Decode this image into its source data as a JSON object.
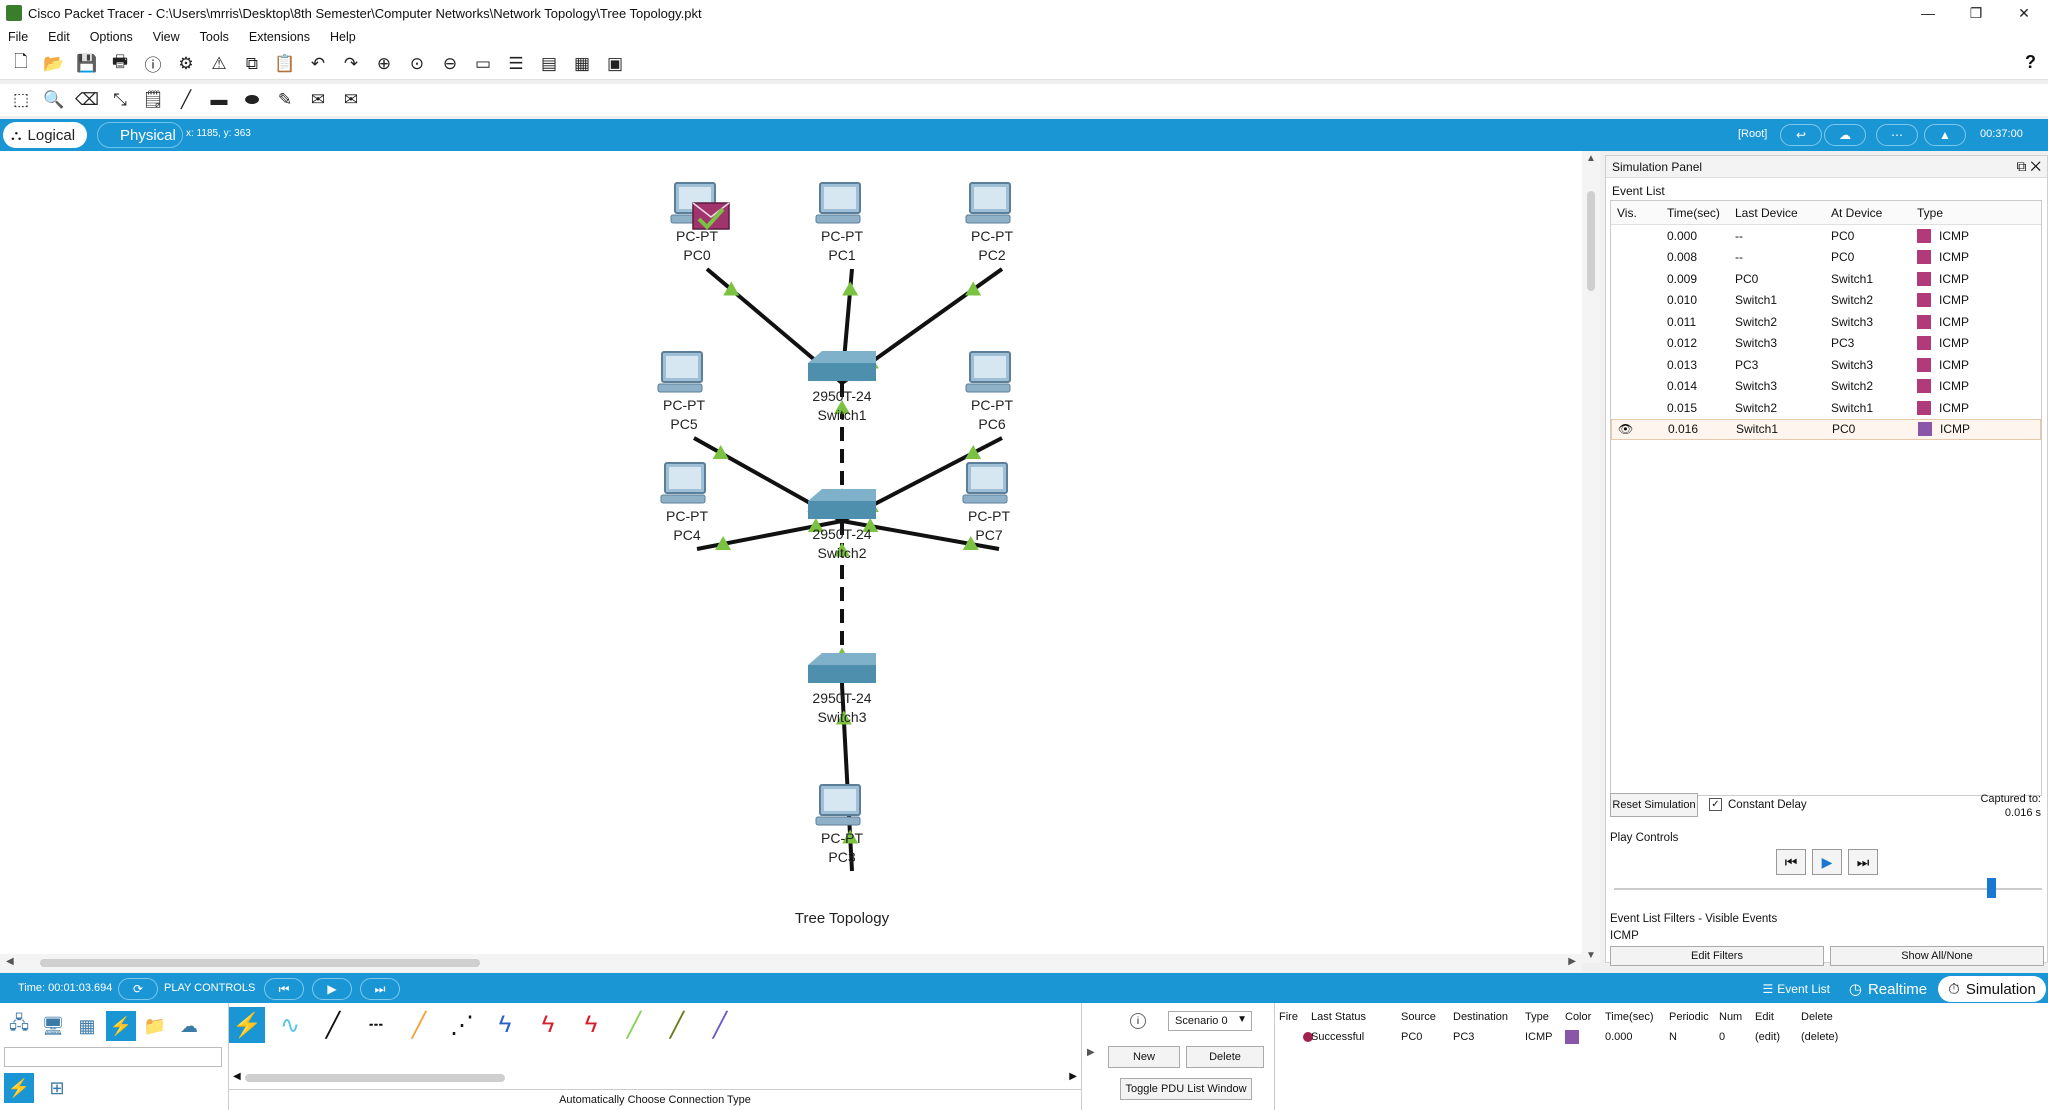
{
  "window": {
    "title": "Cisco Packet Tracer - C:\\Users\\mrris\\Desktop\\8th Semester\\Computer Networks\\Network Topology\\Tree Topology.pkt",
    "controls": [
      "—",
      "❐",
      "✕"
    ]
  },
  "menu": [
    "File",
    "Edit",
    "Options",
    "View",
    "Tools",
    "Extensions",
    "Help"
  ],
  "toolbar1": {
    "icons": [
      "new-icon",
      "open-icon",
      "save-icon",
      "print-icon",
      "info-icon",
      "wizard-icon",
      "network-info-icon",
      "copy-icon",
      "paste-icon",
      "undo-icon",
      "redo-icon",
      "zoom-in-icon",
      "zoom-reset-icon",
      "zoom-out-icon",
      "drawing-palette-icon",
      "custom-device-icon",
      "viewport-icon",
      "activity-wizard-icon",
      "screenshot-icon"
    ],
    "help": "?"
  },
  "toolbar2": {
    "icons": [
      "select-icon",
      "inspect-icon",
      "delete-icon",
      "resize-icon",
      "note-icon",
      "draw-line-icon",
      "rectangle-icon",
      "ellipse-icon",
      "freeform-icon",
      "add-simple-pdu-icon",
      "add-complex-pdu-icon"
    ]
  },
  "modebar": {
    "logical": "Logical",
    "physical": "Physical",
    "coords": "x: 1185, y: 363",
    "root": "[Root]",
    "clock": "00:37:00"
  },
  "topology": {
    "devices": [
      {
        "id": "pc0",
        "model": "PC-PT",
        "name": "PC0",
        "kind": "pc"
      },
      {
        "id": "pc1",
        "model": "PC-PT",
        "name": "PC1",
        "kind": "pc"
      },
      {
        "id": "pc2",
        "model": "PC-PT",
        "name": "PC2",
        "kind": "pc"
      },
      {
        "id": "pc5",
        "model": "PC-PT",
        "name": "PC5",
        "kind": "pc"
      },
      {
        "id": "pc6",
        "model": "PC-PT",
        "name": "PC6",
        "kind": "pc"
      },
      {
        "id": "pc4",
        "model": "PC-PT",
        "name": "PC4",
        "kind": "pc"
      },
      {
        "id": "pc7",
        "model": "PC-PT",
        "name": "PC7",
        "kind": "pc"
      },
      {
        "id": "pc3",
        "model": "PC-PT",
        "name": "PC3",
        "kind": "pc"
      },
      {
        "id": "sw1",
        "model": "2950T-24",
        "name": "Switch1",
        "kind": "switch"
      },
      {
        "id": "sw2",
        "model": "2950T-24",
        "name": "Switch2",
        "kind": "switch"
      },
      {
        "id": "sw3",
        "model": "2950T-24",
        "name": "Switch3",
        "kind": "switch"
      }
    ],
    "caption": "Tree Topology",
    "link_status_color": "#7cc242"
  },
  "sim_panel": {
    "title": "Simulation Panel",
    "event_list_title": "Event List",
    "columns": [
      "Vis.",
      "Time(sec)",
      "Last Device",
      "At Device",
      "Type"
    ],
    "events": [
      {
        "time": "0.000",
        "last": "--",
        "at": "PC0",
        "type": "ICMP",
        "color": "#b03a7a"
      },
      {
        "time": "0.008",
        "last": "--",
        "at": "PC0",
        "type": "ICMP",
        "color": "#b03a7a"
      },
      {
        "time": "0.009",
        "last": "PC0",
        "at": "Switch1",
        "type": "ICMP",
        "color": "#b03a7a"
      },
      {
        "time": "0.010",
        "last": "Switch1",
        "at": "Switch2",
        "type": "ICMP",
        "color": "#b03a7a"
      },
      {
        "time": "0.011",
        "last": "Switch2",
        "at": "Switch3",
        "type": "ICMP",
        "color": "#b03a7a"
      },
      {
        "time": "0.012",
        "last": "Switch3",
        "at": "PC3",
        "type": "ICMP",
        "color": "#b03a7a"
      },
      {
        "time": "0.013",
        "last": "PC3",
        "at": "Switch3",
        "type": "ICMP",
        "color": "#b03a7a"
      },
      {
        "time": "0.014",
        "last": "Switch3",
        "at": "Switch2",
        "type": "ICMP",
        "color": "#b03a7a"
      },
      {
        "time": "0.015",
        "last": "Switch2",
        "at": "Switch1",
        "type": "ICMP",
        "color": "#b03a7a"
      },
      {
        "time": "0.016",
        "last": "Switch1",
        "at": "PC0",
        "type": "ICMP",
        "color": "#8a56a8",
        "selected": true
      }
    ],
    "reset": "Reset Simulation",
    "constant_delay": "Constant Delay",
    "captured_label": "Captured to:",
    "captured_value": "0.016 s",
    "play_controls": "Play Controls",
    "slider_position": 0.88,
    "filters_title": "Event List Filters - Visible Events",
    "filters_value": "ICMP",
    "edit_filters": "Edit Filters",
    "show_all": "Show All/None"
  },
  "bottombar": {
    "time": "Time: 00:01:03.694",
    "play_controls": "PLAY CONTROLS",
    "event_list": "Event List",
    "realtime": "Realtime",
    "simulation": "Simulation"
  },
  "bottom": {
    "device_categories": [
      "network-devices-icon",
      "end-devices-icon",
      "components-icon",
      "connections-icon",
      "misc-icon",
      "multiuser-icon"
    ],
    "subcategories": [
      "connections-icon",
      "grid-icon"
    ],
    "cables": [
      "auto-connection-icon",
      "console-cable-icon",
      "straight-through-icon",
      "crossover-icon",
      "fiber-icon",
      "phone-icon",
      "coaxial-icon",
      "serial-dce-icon",
      "serial-dte-icon",
      "octal-icon",
      "iot-custom-cable-icon",
      "usb-icon",
      "wireless-icon"
    ],
    "cable_caption": "Automatically Choose Connection Type",
    "scenario": "Scenario 0",
    "new": "New",
    "delete": "Delete",
    "toggle_pdu": "Toggle PDU List Window",
    "pdu_columns": [
      "Fire",
      "Last Status",
      "Source",
      "Destination",
      "Type",
      "Color",
      "Time(sec)",
      "Periodic",
      "Num",
      "Edit",
      "Delete"
    ],
    "pdus": [
      {
        "status": "Successful",
        "source": "PC0",
        "destination": "PC3",
        "type": "ICMP",
        "color": "#8a56a8",
        "time": "0.000",
        "periodic": "N",
        "num": "0",
        "edit": "(edit)",
        "delete": "(delete)"
      }
    ]
  }
}
